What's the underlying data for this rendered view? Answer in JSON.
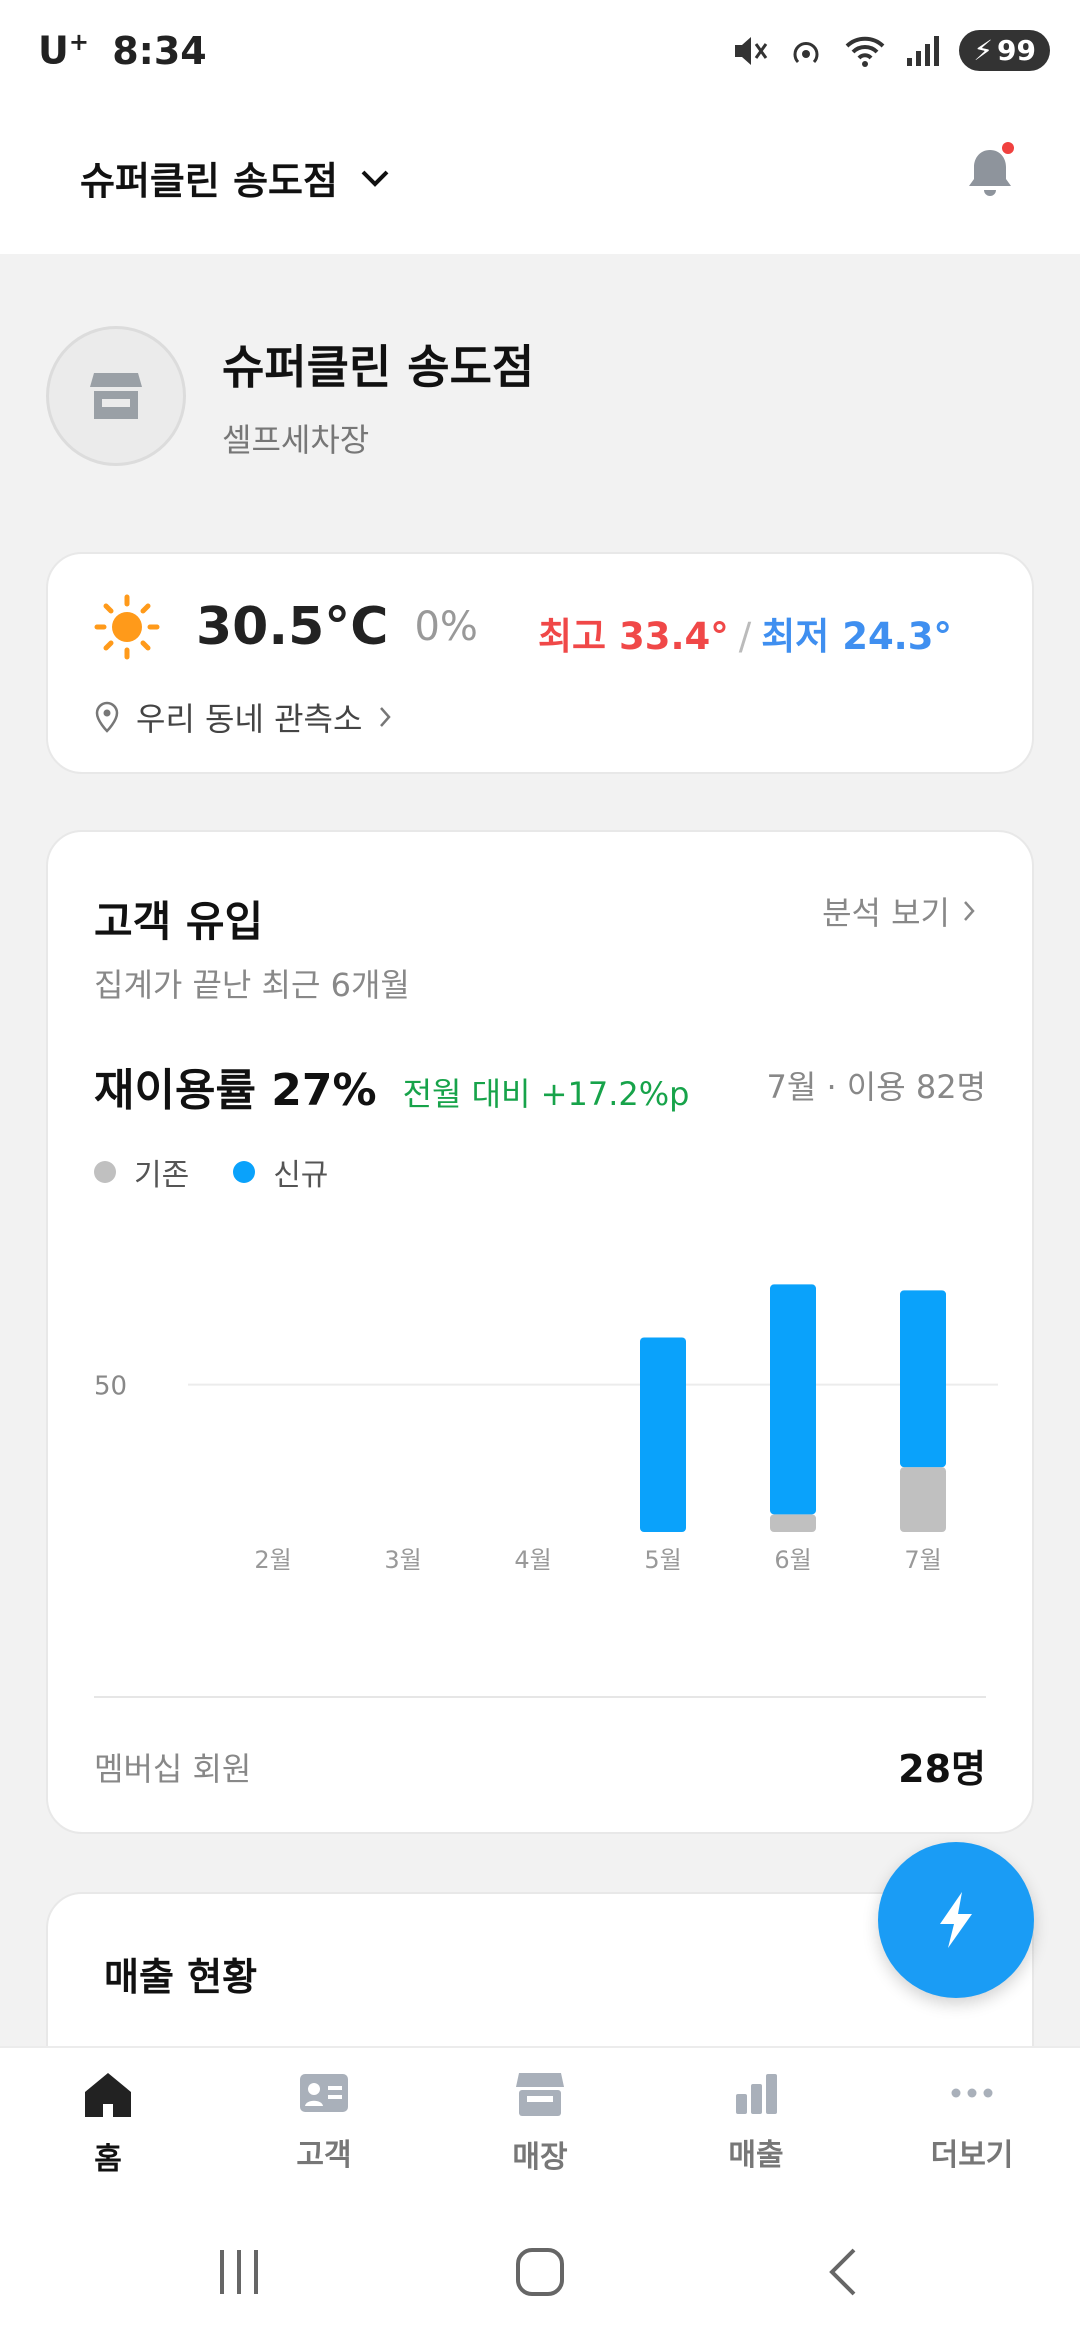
{
  "status": {
    "carrier": "U",
    "carrier_sup": "+",
    "time": "8:34",
    "battery": "99"
  },
  "header": {
    "store_name": "슈퍼클린 송도점"
  },
  "profile": {
    "name": "슈퍼클린 송도점",
    "type": "셀프세차장"
  },
  "weather": {
    "temperature": "30.5°C",
    "precipitation": "0%",
    "high": "최고 33.4°",
    "separator": "/",
    "low": "최저 24.3°",
    "station": "우리 동네 관측소"
  },
  "inflow": {
    "title": "고객 유입",
    "analysis_link": "분석 보기",
    "subtitle": "집계가 끝난 최근 6개월",
    "reuse_rate": "재이용률 27%",
    "delta": "전월 대비 +17.2%p",
    "month_info": "7월 · 이용 82명",
    "membership_label": "멤버십 회원",
    "membership_value": "28명"
  },
  "chart_data": {
    "type": "bar",
    "stacked": true,
    "categories": [
      "2월",
      "3월",
      "4월",
      "5월",
      "6월",
      "7월"
    ],
    "series": [
      {
        "name": "기존",
        "color": "#c0c0c0",
        "values": [
          0,
          0,
          0,
          0,
          6,
          22
        ]
      },
      {
        "name": "신규",
        "color": "#0aa2fb",
        "values": [
          0,
          0,
          0,
          66,
          78,
          60
        ]
      }
    ],
    "y_ticks": [
      50
    ],
    "ylim": [
      0,
      95
    ],
    "grid": true,
    "legend": "top-left"
  },
  "sales": {
    "title": "매출 현황"
  },
  "nav": {
    "items": [
      {
        "label": "홈",
        "icon": "home-icon"
      },
      {
        "label": "고객",
        "icon": "customer-card-icon"
      },
      {
        "label": "매장",
        "icon": "store-icon"
      },
      {
        "label": "매출",
        "icon": "bar-chart-icon"
      },
      {
        "label": "더보기",
        "icon": "more-icon"
      }
    ]
  },
  "colors": {
    "accent": "#1a9cf5",
    "new_customer": "#0aa2fb",
    "existing_customer": "#c0c0c0",
    "high_temp": "#f04848",
    "low_temp": "#3f8ff0",
    "positive_delta": "#17a34a"
  }
}
